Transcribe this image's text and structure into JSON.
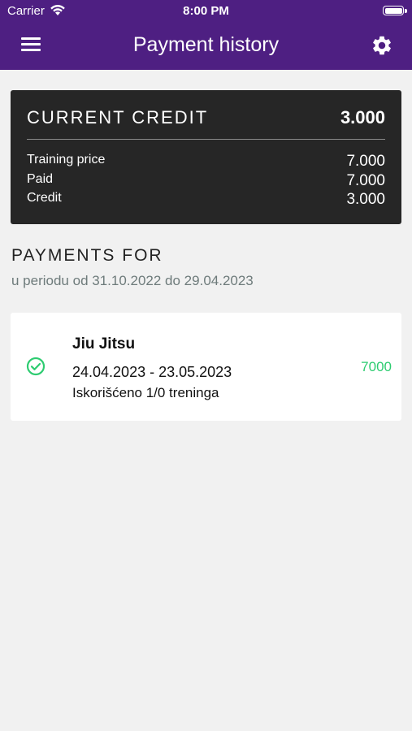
{
  "status_bar": {
    "carrier": "Carrier",
    "time": "8:00 PM"
  },
  "header": {
    "title": "Payment history",
    "menu_icon": "hamburger-menu-icon",
    "settings_icon": "gear-icon",
    "background_color": "#4e1f82"
  },
  "credit_card": {
    "label": "CURRENT CREDIT",
    "value": "3.000",
    "rows": [
      {
        "label": "Training price",
        "value": "7.000"
      },
      {
        "label": "Paid",
        "value": "7.000"
      },
      {
        "label": "Credit",
        "value": "3.000"
      }
    ]
  },
  "payments_section": {
    "title": "PAYMENTS FOR",
    "period": "u periodu od 31.10.2022 do 29.04.2023"
  },
  "payments": [
    {
      "title": "Jiu Jitsu",
      "dates": "24.04.2023 - 23.05.2023",
      "usage": "Iskorišćeno 1/0 treninga",
      "amount": "7000",
      "status_icon": "check-circle-icon",
      "status_color": "#2ecc71"
    }
  ]
}
